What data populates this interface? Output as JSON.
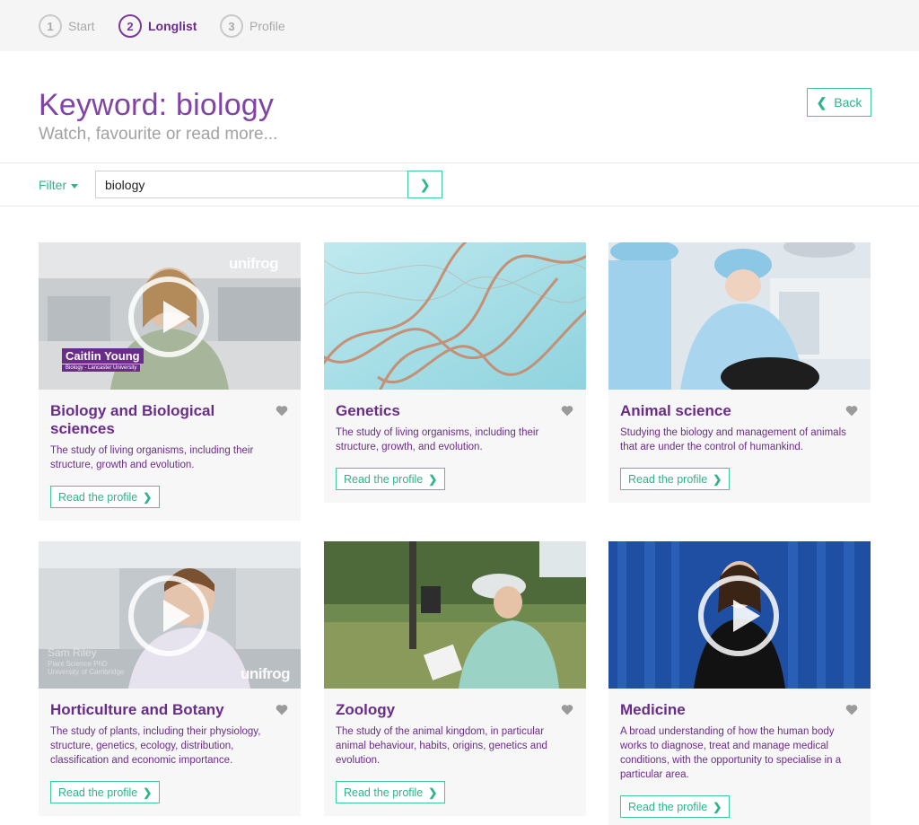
{
  "steps": [
    {
      "number": "1",
      "label": "Start",
      "active": false
    },
    {
      "number": "2",
      "label": "Longlist",
      "active": true
    },
    {
      "number": "3",
      "label": "Profile",
      "active": false
    }
  ],
  "header": {
    "title": "Keyword: biology",
    "subtitle": "Watch, favourite or read more...",
    "back_label": "Back"
  },
  "filter": {
    "label": "Filter",
    "search_value": "biology"
  },
  "icons": {
    "play": "play-icon",
    "heart": "heart-icon",
    "chevron": "chevron-right-icon"
  },
  "colors": {
    "brand_purple": "#6a2c8a",
    "accent_green": "#2fb38d"
  },
  "cards": [
    {
      "title": "Biology and Biological sciences",
      "description": "The study of living organisms, including their structure, growth and evolution.",
      "button": "Read the profile",
      "video": true,
      "overlay_name": "Caitlin Young",
      "overlay_sub": "Biology - Lancaster University",
      "brand": "unifrog"
    },
    {
      "title": "Genetics",
      "description": "The study of living organisms, including their structure, growth, and evolution.",
      "button": "Read the profile",
      "video": false
    },
    {
      "title": "Animal science",
      "description": "Studying the biology and management of animals that are under the control of humankind.",
      "button": "Read the profile",
      "video": false
    },
    {
      "title": "Horticulture and Botany",
      "description": "The study of plants, including their physiology, structure, genetics, ecology, distribution, classification and economic importance.",
      "button": "Read the profile",
      "video": true,
      "overlay_name": "Sam Riley",
      "overlay_sub": "Plant Science PhD\nUniversity of Cambridge",
      "brand": "unifrog"
    },
    {
      "title": "Zoology",
      "description": "The study of the animal kingdom, in particular animal behaviour, habits, origins, genetics and evolution.",
      "button": "Read the profile",
      "video": false
    },
    {
      "title": "Medicine",
      "description": "A broad understanding of how the human body works to diagnose, treat and manage medical conditions, with the opportunity to specialise in a particular area.",
      "button": "Read the profile",
      "video": true
    }
  ]
}
